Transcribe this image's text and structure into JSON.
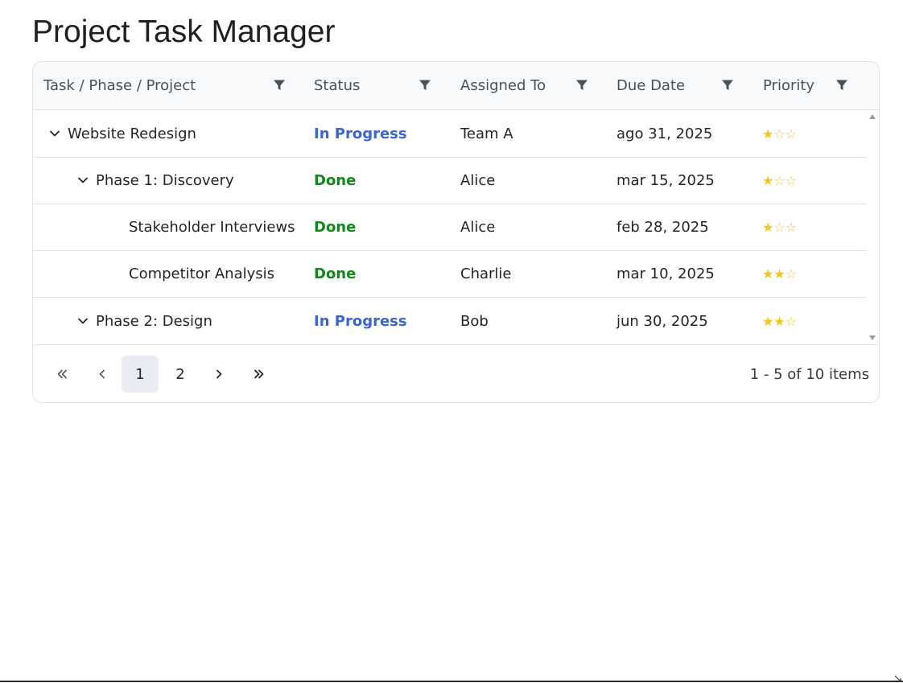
{
  "page": {
    "title": "Project Task Manager"
  },
  "grid": {
    "columns": [
      {
        "label": "Task / Phase / Project"
      },
      {
        "label": "Status"
      },
      {
        "label": "Assigned To"
      },
      {
        "label": "Due Date"
      },
      {
        "label": "Priority"
      }
    ],
    "rows": [
      {
        "task": "Website Redesign",
        "level": 0,
        "expandable": true,
        "status": "In Progress",
        "status_kind": "progress",
        "assigned": "Team A",
        "due": "ago 31, 2025",
        "priority": 1,
        "priority_display": "★☆☆"
      },
      {
        "task": "Phase 1: Discovery",
        "level": 1,
        "expandable": true,
        "status": "Done",
        "status_kind": "done",
        "assigned": "Alice",
        "due": "mar 15, 2025",
        "priority": 1,
        "priority_display": "★☆☆"
      },
      {
        "task": "Stakeholder Interviews",
        "level": 2,
        "expandable": false,
        "status": "Done",
        "status_kind": "done",
        "assigned": "Alice",
        "due": "feb 28, 2025",
        "priority": 1,
        "priority_display": "★☆☆"
      },
      {
        "task": "Competitor Analysis",
        "level": 2,
        "expandable": false,
        "status": "Done",
        "status_kind": "done",
        "assigned": "Charlie",
        "due": "mar 10, 2025",
        "priority": 2,
        "priority_display": "★★☆"
      },
      {
        "task": "Phase 2: Design",
        "level": 1,
        "expandable": true,
        "status": "In Progress",
        "status_kind": "progress",
        "assigned": "Bob",
        "due": "jun 30, 2025",
        "priority": 2,
        "priority_display": "★★☆"
      }
    ]
  },
  "pager": {
    "first_icon": "double-chevron-left-icon",
    "prev_icon": "chevron-left-icon",
    "pages": [
      "1",
      "2"
    ],
    "current_page": "1",
    "next_icon": "chevron-right-icon",
    "last_icon": "double-chevron-right-icon",
    "info": "1 - 5 of 10 items"
  },
  "colors": {
    "in_progress": "#3a65d4",
    "done": "#0e8a16",
    "star": "#f5c518",
    "header_bg": "#f8f9fa",
    "active_page_bg": "#e9ecf3"
  }
}
